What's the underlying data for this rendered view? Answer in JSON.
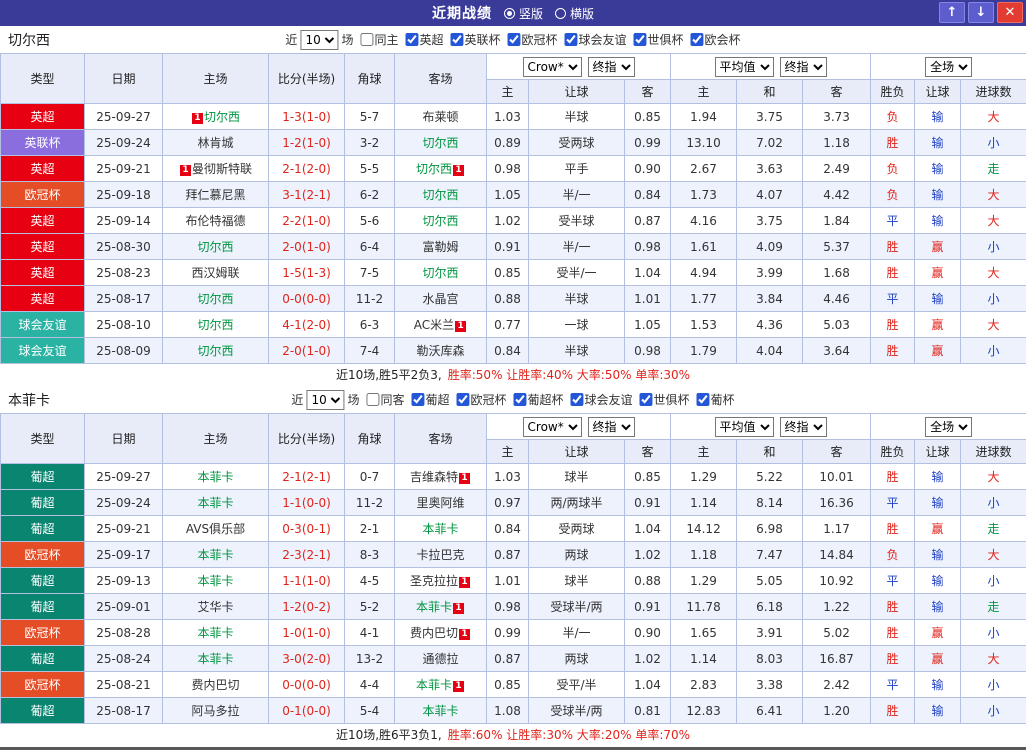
{
  "titlebar": {
    "title": "近期战绩",
    "radio_vertical": "竖版",
    "radio_horizontal": "横版",
    "up_icon": "↑",
    "down_icon": "↓",
    "close_icon": "✕"
  },
  "league_colors": {
    "英超": "#e60012",
    "英联杯": "#8a6ede",
    "欧冠杯": "#e44d26",
    "球会友谊": "#2ab3a3",
    "葡超": "#0a8570"
  },
  "sections": [
    {
      "team": "切尔西",
      "filter": {
        "near_label": "近",
        "count": "10",
        "games_label": "场",
        "same_venue": "同主",
        "leagues": [
          "英超",
          "英联杯",
          "欧冠杯",
          "球会友谊",
          "世俱杯",
          "欧会杯"
        ]
      },
      "dropdowns": {
        "odds_source": "Crow*",
        "odds_time": "终指",
        "avg_source": "平均值",
        "avg_time": "终指",
        "scope": "全场"
      },
      "headers": [
        "类型",
        "日期",
        "主场",
        "比分(半场)",
        "角球",
        "客场",
        "主",
        "让球",
        "客",
        "主",
        "和",
        "客",
        "胜负",
        "让球",
        "进球数"
      ],
      "rows": [
        {
          "league": "英超",
          "date": "25-09-27",
          "home": {
            "name": "切尔西",
            "focus": true,
            "badge_pre": true
          },
          "score": "1-3(1-0)",
          "corners": "5-7",
          "away": {
            "name": "布莱顿"
          },
          "odds": [
            "1.03",
            "半球",
            "0.85"
          ],
          "avg": [
            "1.94",
            "3.75",
            "3.73"
          ],
          "result": "负",
          "let_result": "输",
          "goals": "大"
        },
        {
          "league": "英联杯",
          "date": "25-09-24",
          "home": {
            "name": "林肯城"
          },
          "score": "1-2(1-0)",
          "corners": "3-2",
          "away": {
            "name": "切尔西",
            "focus": true
          },
          "odds": [
            "0.89",
            "受两球",
            "0.99"
          ],
          "avg": [
            "13.10",
            "7.02",
            "1.18"
          ],
          "result": "胜",
          "let_result": "输",
          "goals": "小"
        },
        {
          "league": "英超",
          "date": "25-09-21",
          "home": {
            "name": "曼彻斯特联",
            "badge_pre": true
          },
          "score": "2-1(2-0)",
          "corners": "5-5",
          "away": {
            "name": "切尔西",
            "focus": true,
            "badge_post": true
          },
          "odds": [
            "0.98",
            "平手",
            "0.90"
          ],
          "avg": [
            "2.67",
            "3.63",
            "2.49"
          ],
          "result": "负",
          "let_result": "输",
          "goals": "走"
        },
        {
          "league": "欧冠杯",
          "date": "25-09-18",
          "home": {
            "name": "拜仁慕尼黑"
          },
          "score": "3-1(2-1)",
          "corners": "6-2",
          "away": {
            "name": "切尔西",
            "focus": true
          },
          "odds": [
            "1.05",
            "半/一",
            "0.84"
          ],
          "avg": [
            "1.73",
            "4.07",
            "4.42"
          ],
          "result": "负",
          "let_result": "输",
          "goals": "大"
        },
        {
          "league": "英超",
          "date": "25-09-14",
          "home": {
            "name": "布伦特福德"
          },
          "score": "2-2(1-0)",
          "corners": "5-6",
          "away": {
            "name": "切尔西",
            "focus": true
          },
          "odds": [
            "1.02",
            "受半球",
            "0.87"
          ],
          "avg": [
            "4.16",
            "3.75",
            "1.84"
          ],
          "result": "平",
          "let_result": "输",
          "goals": "大"
        },
        {
          "league": "英超",
          "date": "25-08-30",
          "home": {
            "name": "切尔西",
            "focus": true
          },
          "score": "2-0(1-0)",
          "corners": "6-4",
          "away": {
            "name": "富勒姆"
          },
          "odds": [
            "0.91",
            "半/一",
            "0.98"
          ],
          "avg": [
            "1.61",
            "4.09",
            "5.37"
          ],
          "result": "胜",
          "let_result": "赢",
          "goals": "小"
        },
        {
          "league": "英超",
          "date": "25-08-23",
          "home": {
            "name": "西汉姆联"
          },
          "score": "1-5(1-3)",
          "corners": "7-5",
          "away": {
            "name": "切尔西",
            "focus": true
          },
          "odds": [
            "0.85",
            "受半/一",
            "1.04"
          ],
          "avg": [
            "4.94",
            "3.99",
            "1.68"
          ],
          "result": "胜",
          "let_result": "赢",
          "goals": "大"
        },
        {
          "league": "英超",
          "date": "25-08-17",
          "home": {
            "name": "切尔西",
            "focus": true
          },
          "score": "0-0(0-0)",
          "corners": "11-2",
          "away": {
            "name": "水晶宫"
          },
          "odds": [
            "0.88",
            "半球",
            "1.01"
          ],
          "avg": [
            "1.77",
            "3.84",
            "4.46"
          ],
          "result": "平",
          "let_result": "输",
          "goals": "小"
        },
        {
          "league": "球会友谊",
          "date": "25-08-10",
          "home": {
            "name": "切尔西",
            "focus": true
          },
          "score": "4-1(2-0)",
          "corners": "6-3",
          "away": {
            "name": "AC米兰",
            "badge_post": true
          },
          "odds": [
            "0.77",
            "一球",
            "1.05"
          ],
          "avg": [
            "1.53",
            "4.36",
            "5.03"
          ],
          "result": "胜",
          "let_result": "赢",
          "goals": "大"
        },
        {
          "league": "球会友谊",
          "date": "25-08-09",
          "home": {
            "name": "切尔西",
            "focus": true
          },
          "score": "2-0(1-0)",
          "corners": "7-4",
          "away": {
            "name": "勒沃库森"
          },
          "odds": [
            "0.84",
            "半球",
            "0.98"
          ],
          "avg": [
            "1.79",
            "4.04",
            "3.64"
          ],
          "result": "胜",
          "let_result": "赢",
          "goals": "小"
        }
      ],
      "summary": {
        "prefix": "近10场,胜5平2负3,",
        "stats": "胜率:50% 让胜率:40% 大率:50% 单率:30%"
      }
    },
    {
      "team": "本菲卡",
      "filter": {
        "near_label": "近",
        "count": "10",
        "games_label": "场",
        "same_venue": "同客",
        "leagues": [
          "葡超",
          "欧冠杯",
          "葡超杯",
          "球会友谊",
          "世俱杯",
          "葡杯"
        ]
      },
      "dropdowns": {
        "odds_source": "Crow*",
        "odds_time": "终指",
        "avg_source": "平均值",
        "avg_time": "终指",
        "scope": "全场"
      },
      "headers": [
        "类型",
        "日期",
        "主场",
        "比分(半场)",
        "角球",
        "客场",
        "主",
        "让球",
        "客",
        "主",
        "和",
        "客",
        "胜负",
        "让球",
        "进球数"
      ],
      "rows": [
        {
          "league": "葡超",
          "date": "25-09-27",
          "home": {
            "name": "本菲卡",
            "focus": true
          },
          "score": "2-1(2-1)",
          "corners": "0-7",
          "away": {
            "name": "吉维森特",
            "badge_post": true
          },
          "odds": [
            "1.03",
            "球半",
            "0.85"
          ],
          "avg": [
            "1.29",
            "5.22",
            "10.01"
          ],
          "result": "胜",
          "let_result": "输",
          "goals": "大"
        },
        {
          "league": "葡超",
          "date": "25-09-24",
          "home": {
            "name": "本菲卡",
            "focus": true
          },
          "score": "1-1(0-0)",
          "corners": "11-2",
          "away": {
            "name": "里奥阿维"
          },
          "odds": [
            "0.97",
            "两/两球半",
            "0.91"
          ],
          "avg": [
            "1.14",
            "8.14",
            "16.36"
          ],
          "result": "平",
          "let_result": "输",
          "goals": "小"
        },
        {
          "league": "葡超",
          "date": "25-09-21",
          "home": {
            "name": "AVS俱乐部"
          },
          "score": "0-3(0-1)",
          "corners": "2-1",
          "away": {
            "name": "本菲卡",
            "focus": true
          },
          "odds": [
            "0.84",
            "受两球",
            "1.04"
          ],
          "avg": [
            "14.12",
            "6.98",
            "1.17"
          ],
          "result": "胜",
          "let_result": "赢",
          "goals": "走"
        },
        {
          "league": "欧冠杯",
          "date": "25-09-17",
          "home": {
            "name": "本菲卡",
            "focus": true
          },
          "score": "2-3(2-1)",
          "corners": "8-3",
          "away": {
            "name": "卡拉巴克"
          },
          "odds": [
            "0.87",
            "两球",
            "1.02"
          ],
          "avg": [
            "1.18",
            "7.47",
            "14.84"
          ],
          "result": "负",
          "let_result": "输",
          "goals": "大"
        },
        {
          "league": "葡超",
          "date": "25-09-13",
          "home": {
            "name": "本菲卡",
            "focus": true
          },
          "score": "1-1(1-0)",
          "corners": "4-5",
          "away": {
            "name": "圣克拉拉",
            "badge_post": true
          },
          "odds": [
            "1.01",
            "球半",
            "0.88"
          ],
          "avg": [
            "1.29",
            "5.05",
            "10.92"
          ],
          "result": "平",
          "let_result": "输",
          "goals": "小"
        },
        {
          "league": "葡超",
          "date": "25-09-01",
          "home": {
            "name": "艾华卡"
          },
          "score": "1-2(0-2)",
          "corners": "5-2",
          "away": {
            "name": "本菲卡",
            "focus": true,
            "badge_post": true
          },
          "odds": [
            "0.98",
            "受球半/两",
            "0.91"
          ],
          "avg": [
            "11.78",
            "6.18",
            "1.22"
          ],
          "result": "胜",
          "let_result": "输",
          "goals": "走"
        },
        {
          "league": "欧冠杯",
          "date": "25-08-28",
          "home": {
            "name": "本菲卡",
            "focus": true
          },
          "score": "1-0(1-0)",
          "corners": "4-1",
          "away": {
            "name": "费内巴切",
            "badge_post": true
          },
          "odds": [
            "0.99",
            "半/一",
            "0.90"
          ],
          "avg": [
            "1.65",
            "3.91",
            "5.02"
          ],
          "result": "胜",
          "let_result": "赢",
          "goals": "小"
        },
        {
          "league": "葡超",
          "date": "25-08-24",
          "home": {
            "name": "本菲卡",
            "focus": true
          },
          "score": "3-0(2-0)",
          "corners": "13-2",
          "away": {
            "name": "通德拉"
          },
          "odds": [
            "0.87",
            "两球",
            "1.02"
          ],
          "avg": [
            "1.14",
            "8.03",
            "16.87"
          ],
          "result": "胜",
          "let_result": "赢",
          "goals": "大"
        },
        {
          "league": "欧冠杯",
          "date": "25-08-21",
          "home": {
            "name": "费内巴切"
          },
          "score": "0-0(0-0)",
          "corners": "4-4",
          "away": {
            "name": "本菲卡",
            "focus": true,
            "badge_post": true
          },
          "odds": [
            "0.85",
            "受平/半",
            "1.04"
          ],
          "avg": [
            "2.83",
            "3.38",
            "2.42"
          ],
          "result": "平",
          "let_result": "输",
          "goals": "小"
        },
        {
          "league": "葡超",
          "date": "25-08-17",
          "home": {
            "name": "阿马多拉"
          },
          "score": "0-1(0-0)",
          "corners": "5-4",
          "away": {
            "name": "本菲卡",
            "focus": true
          },
          "odds": [
            "1.08",
            "受球半/两",
            "0.81"
          ],
          "avg": [
            "12.83",
            "6.41",
            "1.20"
          ],
          "result": "胜",
          "let_result": "输",
          "goals": "小"
        }
      ],
      "summary": {
        "prefix": "近10场,胜6平3负1,",
        "stats": "胜率:60% 让胜率:30% 大率:20% 单率:70%"
      }
    }
  ]
}
